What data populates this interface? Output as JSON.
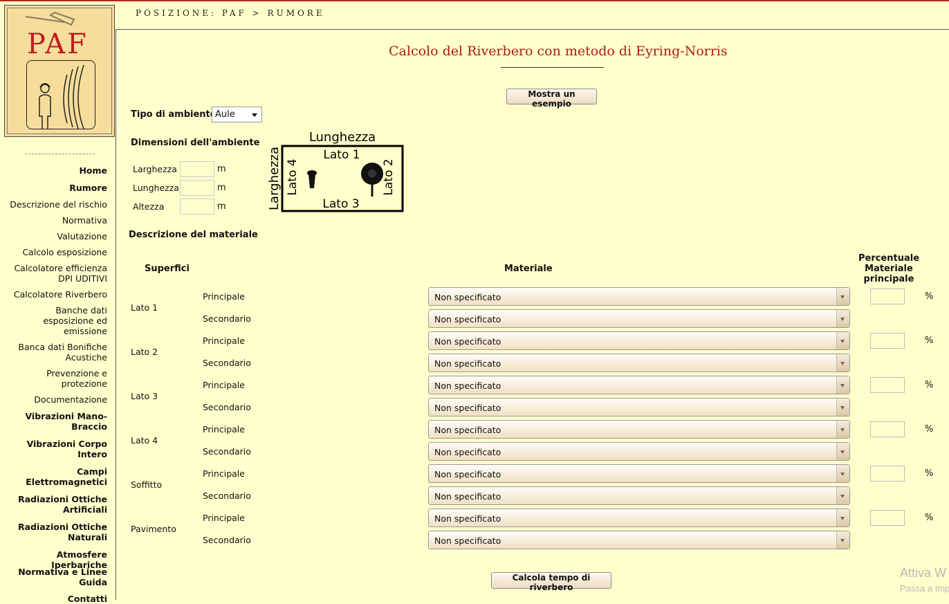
{
  "logo": {
    "text": "PAF"
  },
  "breadcrumb": "POSIZIONE: PAF > RUMORE",
  "nav": [
    {
      "label": "Home"
    },
    {
      "label": "Rumore"
    },
    {
      "label": "Descrizione del rischio"
    },
    {
      "label": "Normativa"
    },
    {
      "label": "Valutazione"
    },
    {
      "label": "Calcolo esposizione"
    },
    {
      "label": "Calcolatore efficienza",
      "label2": "DPI UDITIVI"
    },
    {
      "label": "Calcolatore Riverbero"
    },
    {
      "label": "Banche dati",
      "label2": "esposizione ed",
      "label3": "emissione"
    },
    {
      "label": "Banca dati Bonifiche",
      "label2": "Acustiche"
    },
    {
      "label": "Prevenzione e",
      "label2": "protezione"
    },
    {
      "label": "Documentazione"
    },
    {
      "label": "Vibrazioni Mano-",
      "label2": "Braccio"
    },
    {
      "label": "Vibrazioni Corpo",
      "label2": "Intero"
    },
    {
      "label": "Campi",
      "label2": "Elettromagnetici"
    },
    {
      "label": "Radiazioni Ottiche",
      "label2": "Artificiali"
    },
    {
      "label": "Radiazioni Ottiche",
      "label2": "Naturali"
    },
    {
      "label": "Atmosfere Iperbariche"
    },
    {
      "label": "Normativa e Linee",
      "label2": "Guida"
    },
    {
      "label": "Contatti"
    }
  ],
  "title": "Calcolo del Riverbero con metodo di Eyring-Norris",
  "example_button": "Mostra un esempio",
  "tipo": {
    "label": "Tipo di ambiente",
    "value": "Aule"
  },
  "dimensioni": {
    "label": "Dimensioni dell'ambiente",
    "larghezza": "Larghezza",
    "lunghezza": "Lunghezza",
    "altezza": "Altezza",
    "unit": "m"
  },
  "diagram": {
    "top": "Lunghezza",
    "left": "Larghezza",
    "lato1": "Lato 1",
    "lato2": "Lato 2",
    "lato3": "Lato 3",
    "lato4": "Lato 4"
  },
  "materiale_section": "Descrizione del materiale",
  "table": {
    "col_superfici": "Superfici",
    "col_materiale": "Materiale",
    "col_percentuale": [
      "Percentuale",
      "Materiale",
      "principale"
    ],
    "principale": "Principale",
    "secondario": "Secondario",
    "default_material": "Non specificato",
    "pct_sign": "%",
    "surfaces": [
      "Lato 1",
      "Lato 2",
      "Lato 3",
      "Lato 4",
      "Soffitto",
      "Pavimento"
    ]
  },
  "calc_button": "Calcola tempo di riverbero",
  "watermark": {
    "line1": "Attiva W",
    "line2": "Passa a Imp"
  },
  "colors": {
    "accent": "#b01b15",
    "background": "#ffffcc"
  }
}
